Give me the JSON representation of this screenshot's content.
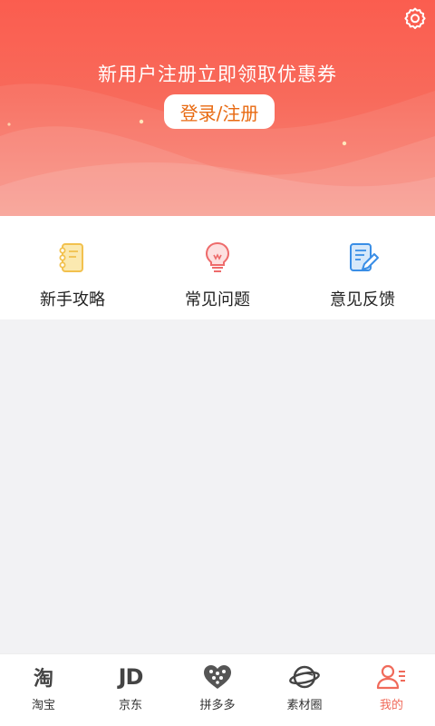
{
  "header": {
    "promo_text": "新用户注册立即领取优惠券",
    "login_label": "登录/注册",
    "settings_icon": "gear-icon"
  },
  "quick_menu": [
    {
      "label": "新手攻略",
      "icon": "notebook-icon",
      "color": "#f2c14e"
    },
    {
      "label": "常见问题",
      "icon": "lightbulb-icon",
      "color": "#ee6b6b"
    },
    {
      "label": "意见反馈",
      "icon": "feedback-edit-icon",
      "color": "#3a8ee6"
    }
  ],
  "tabbar": [
    {
      "label": "淘宝",
      "icon": "taobao-icon",
      "glyph": "淘",
      "active": false
    },
    {
      "label": "京东",
      "icon": "jd-icon",
      "glyph": "JD",
      "active": false
    },
    {
      "label": "拼多多",
      "icon": "pinduoduo-icon",
      "active": false
    },
    {
      "label": "素材圈",
      "icon": "planet-icon",
      "active": false
    },
    {
      "label": "我的",
      "icon": "profile-icon",
      "active": true
    }
  ],
  "colors": {
    "accent": "#f06a5a",
    "header_top": "#fb5d4f",
    "login_text": "#e86a12"
  }
}
